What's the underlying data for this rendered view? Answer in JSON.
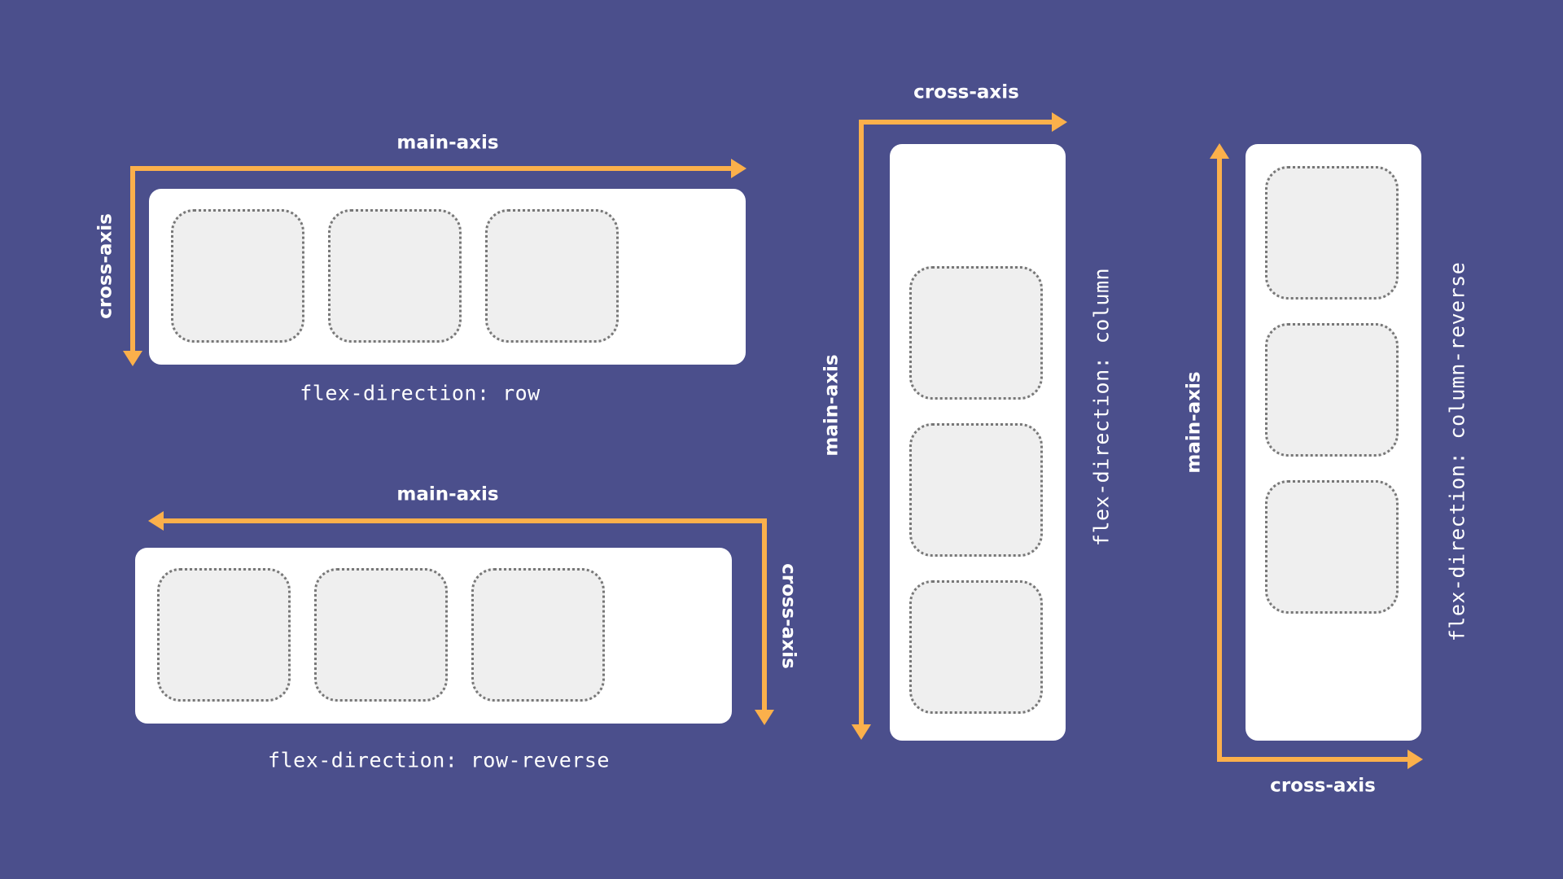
{
  "colors": {
    "background": "#4b4f8c",
    "arrow": "#fbb04b",
    "container": "#ffffff",
    "item_fill": "#efefef",
    "item_border": "#777777"
  },
  "diagrams": {
    "row": {
      "main_axis_label": "main-axis",
      "cross_axis_label": "cross-axis",
      "caption": "flex-direction: row"
    },
    "row_reverse": {
      "main_axis_label": "main-axis",
      "cross_axis_label": "cross-axis",
      "caption": "flex-direction: row-reverse"
    },
    "column": {
      "main_axis_label": "main-axis",
      "cross_axis_label": "cross-axis",
      "caption": "flex-direction: column"
    },
    "column_reverse": {
      "main_axis_label": "main-axis",
      "cross_axis_label": "cross-axis",
      "caption": "flex-direction: column-reverse"
    }
  }
}
